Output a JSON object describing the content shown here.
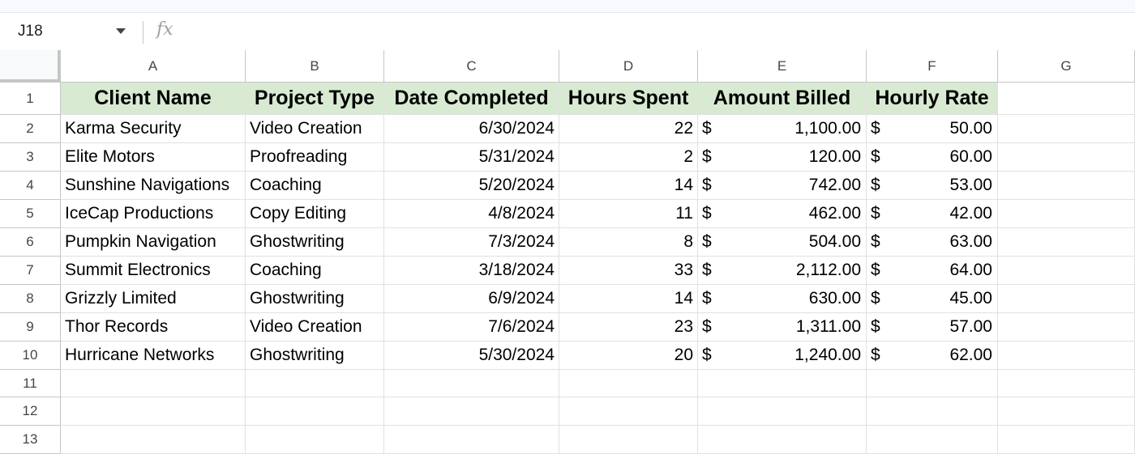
{
  "name_box": {
    "ref": "J18"
  },
  "formula_bar": {
    "fx_label": "fx",
    "value": ""
  },
  "column_headers": [
    "A",
    "B",
    "C",
    "D",
    "E",
    "F",
    "G"
  ],
  "row_numbers": [
    "1",
    "2",
    "3",
    "4",
    "5",
    "6",
    "7",
    "8",
    "9",
    "10",
    "11",
    "12",
    "13"
  ],
  "table": {
    "headers": [
      "Client Name",
      "Project Type",
      "Date Completed",
      "Hours Spent",
      "Amount Billed",
      "Hourly Rate"
    ],
    "currency_symbol": "$",
    "rows": [
      {
        "client": "Karma Security",
        "type": "Video Creation",
        "date": "6/30/2024",
        "hours": "22",
        "amount": "1,100.00",
        "rate": "50.00"
      },
      {
        "client": "Elite Motors",
        "type": "Proofreading",
        "date": "5/31/2024",
        "hours": "2",
        "amount": "120.00",
        "rate": "60.00"
      },
      {
        "client": "Sunshine Navigations",
        "type": "Coaching",
        "date": "5/20/2024",
        "hours": "14",
        "amount": "742.00",
        "rate": "53.00"
      },
      {
        "client": "IceCap Productions",
        "type": "Copy Editing",
        "date": "4/8/2024",
        "hours": "11",
        "amount": "462.00",
        "rate": "42.00"
      },
      {
        "client": "Pumpkin Navigation",
        "type": "Ghostwriting",
        "date": "7/3/2024",
        "hours": "8",
        "amount": "504.00",
        "rate": "63.00"
      },
      {
        "client": "Summit Electronics",
        "type": "Coaching",
        "date": "3/18/2024",
        "hours": "33",
        "amount": "2,112.00",
        "rate": "64.00"
      },
      {
        "client": "Grizzly Limited",
        "type": "Ghostwriting",
        "date": "6/9/2024",
        "hours": "14",
        "amount": "630.00",
        "rate": "45.00"
      },
      {
        "client": "Thor Records",
        "type": "Video Creation",
        "date": "7/6/2024",
        "hours": "23",
        "amount": "1,311.00",
        "rate": "57.00"
      },
      {
        "client": "Hurricane Networks",
        "type": "Ghostwriting",
        "date": "5/30/2024",
        "hours": "20",
        "amount": "1,240.00",
        "rate": "62.00"
      }
    ]
  },
  "colors": {
    "header_fill": "#d9ead3",
    "grid_line": "#e1e1e1",
    "header_border": "#c4c7c5"
  }
}
